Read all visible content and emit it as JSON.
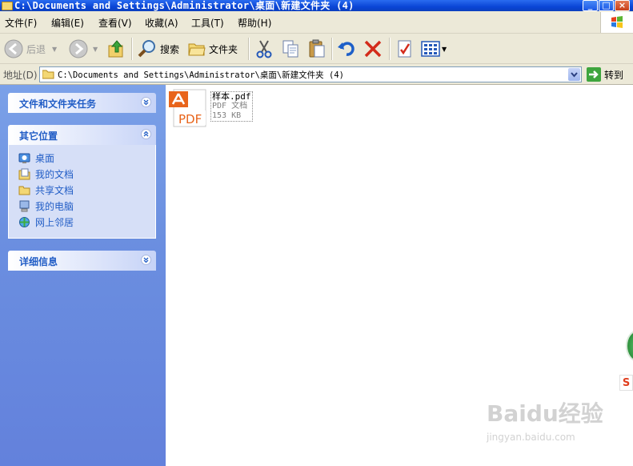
{
  "window": {
    "title": "C:\\Documents and Settings\\Administrator\\桌面\\新建文件夹 (4)"
  },
  "menu": [
    "文件(F)",
    "编辑(E)",
    "查看(V)",
    "收藏(A)",
    "工具(T)",
    "帮助(H)"
  ],
  "toolbar": {
    "back_label": "后退",
    "search_label": "搜索",
    "folders_label": "文件夹"
  },
  "address": {
    "label": "地址(D)",
    "value": "C:\\Documents and Settings\\Administrator\\桌面\\新建文件夹 (4)",
    "go_label": "转到"
  },
  "taskpane": {
    "file_tasks_title": "文件和文件夹任务",
    "other_places_title": "其它位置",
    "other_places": [
      {
        "label": "桌面",
        "icon": "desktop-icon"
      },
      {
        "label": "我的文档",
        "icon": "my-documents-icon"
      },
      {
        "label": "共享文档",
        "icon": "shared-folder-icon"
      },
      {
        "label": "我的电脑",
        "icon": "my-computer-icon"
      },
      {
        "label": "网上邻居",
        "icon": "network-icon"
      }
    ],
    "details_title": "详细信息"
  },
  "files": [
    {
      "name": "样本.pdf",
      "type": "PDF 文档",
      "size": "153 KB",
      "badge": "PDF",
      "icon": "pdf-file-icon"
    }
  ],
  "watermark": {
    "brand": "Baidu经验",
    "url": "jingyan.baidu.com"
  },
  "colors": {
    "titlebar": "#0a46d6",
    "taskpane": "#6b8fe0",
    "link": "#215dc6",
    "pdf_orange": "#e8641b"
  }
}
